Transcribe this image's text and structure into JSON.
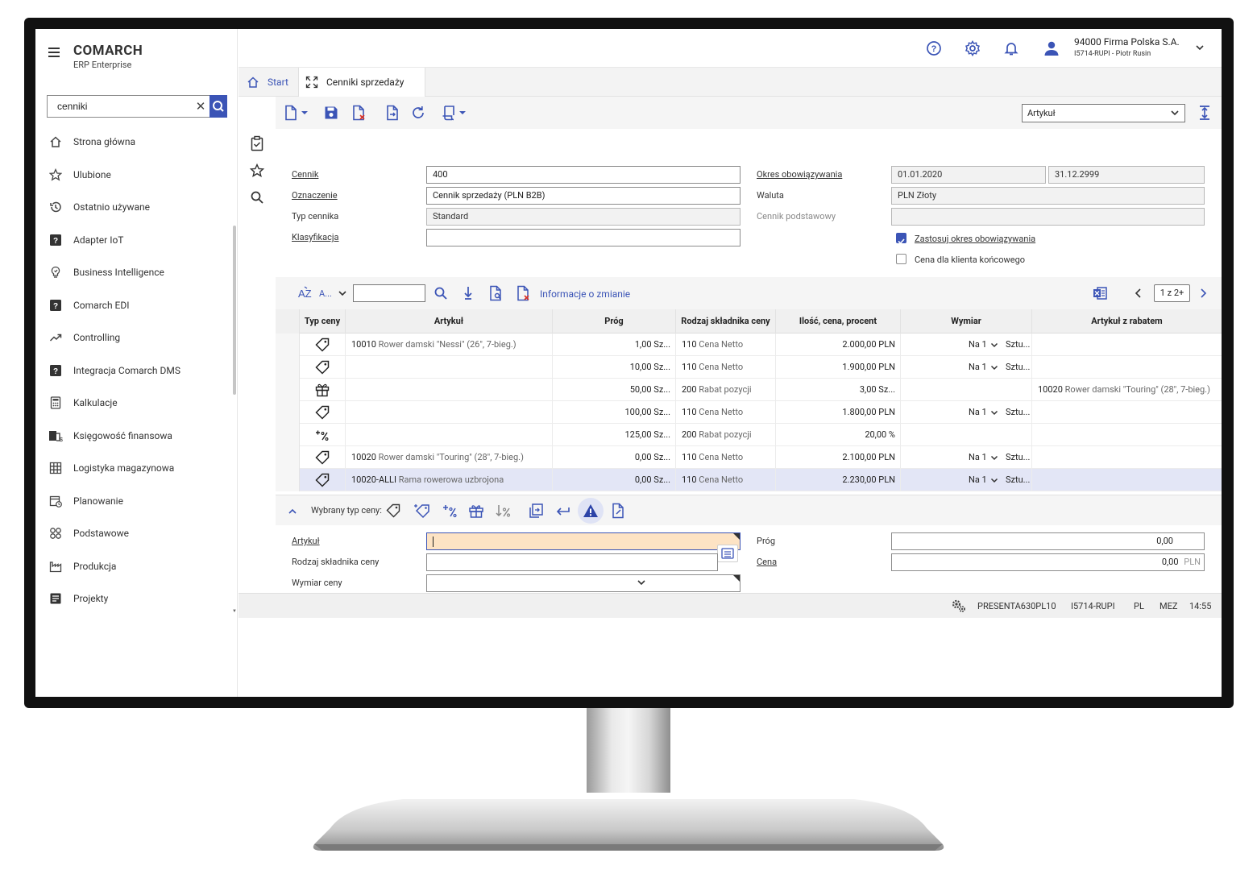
{
  "brand": {
    "name": "COMARCH",
    "product": "ERP Enterprise"
  },
  "search": {
    "value": "cenniki"
  },
  "sidebar": {
    "items": [
      {
        "label": "Strona główna"
      },
      {
        "label": "Ulubione"
      },
      {
        "label": "Ostatnio używane"
      },
      {
        "label": "Adapter IoT"
      },
      {
        "label": "Business Intelligence"
      },
      {
        "label": "Comarch EDI"
      },
      {
        "label": "Controlling"
      },
      {
        "label": "Integracja Comarch DMS"
      },
      {
        "label": "Kalkulacje"
      },
      {
        "label": "Księgowość finansowa"
      },
      {
        "label": "Logistyka magazynowa"
      },
      {
        "label": "Planowanie"
      },
      {
        "label": "Podstawowe"
      },
      {
        "label": "Produkcja"
      },
      {
        "label": "Projekty"
      }
    ]
  },
  "user": {
    "company": "94000  Firma Polska S.A.",
    "detail": "I5714-RUPI - Piotr Rusin"
  },
  "tabs": {
    "start": "Start",
    "active": "Cenniki sprzedaży"
  },
  "toolbar": {
    "view_select": "Artykuł"
  },
  "form": {
    "cennik_label": "Cennik",
    "cennik_value": "400",
    "oznaczenie_label": "Oznaczenie",
    "oznaczenie_value": "Cennik sprzedaży (PLN B2B)",
    "typ_label": "Typ cennika",
    "typ_value": "Standard",
    "klasyfikacja_label": "Klasyfikacja",
    "klasyfikacja_value": "",
    "okres_label": "Okres obowiązywania",
    "okres_from": "01.01.2020",
    "okres_to": "31.12.2999",
    "waluta_label": "Waluta",
    "waluta_value": "PLN Złoty",
    "podstawowy_label": "Cennik podstawowy",
    "podstawowy_value": "",
    "chk1_label": "Zastosuj okres obowiązywania",
    "chk1_checked": true,
    "chk2_label": "Cena dla klienta końcowego",
    "chk2_checked": false
  },
  "gridbar": {
    "sort_label": "A...",
    "link": "Informacje o zmianie",
    "pager": "1 z 2+"
  },
  "grid": {
    "headers": [
      "Typ ceny",
      "Artykuł",
      "Próg",
      "Rodzaj składnika ceny",
      "Ilość, cena, procent",
      "Wymiar",
      "Artykuł z rabatem"
    ],
    "rows": [
      {
        "icon": "tag",
        "art_code": "10010",
        "art_name": "Rower damski \"Nessi\" (26\", 7-bieg.)",
        "prog": "1,00 Sz...",
        "rodzaj_code": "110",
        "rodzaj_name": "Cena Netto",
        "ilosc": "2.000,00 PLN",
        "wymiar_a": "Na 1",
        "wymiar_b": "Sztu...",
        "rab_code": "",
        "rab_name": "",
        "selected": false
      },
      {
        "icon": "tag",
        "art_code": "",
        "art_name": "",
        "prog": "10,00 Sz...",
        "rodzaj_code": "110",
        "rodzaj_name": "Cena Netto",
        "ilosc": "1.900,00 PLN",
        "wymiar_a": "Na 1",
        "wymiar_b": "Sztu...",
        "rab_code": "",
        "rab_name": "",
        "selected": false
      },
      {
        "icon": "gift",
        "art_code": "",
        "art_name": "",
        "prog": "50,00 Sz...",
        "rodzaj_code": "200",
        "rodzaj_name": "Rabat pozycji",
        "ilosc": "3,00 Sz...",
        "wymiar_a": "",
        "wymiar_b": "",
        "rab_code": "10020",
        "rab_name": "Rower damski \"Touring\" (28\", 7-bieg.)",
        "selected": false
      },
      {
        "icon": "tag",
        "art_code": "",
        "art_name": "",
        "prog": "100,00 Sz...",
        "rodzaj_code": "110",
        "rodzaj_name": "Cena Netto",
        "ilosc": "1.800,00 PLN",
        "wymiar_a": "Na 1",
        "wymiar_b": "Sztu...",
        "rab_code": "",
        "rab_name": "",
        "selected": false
      },
      {
        "icon": "percent",
        "art_code": "",
        "art_name": "",
        "prog": "125,00 Sz...",
        "rodzaj_code": "200",
        "rodzaj_name": "Rabat pozycji",
        "ilosc": "20,00 %",
        "wymiar_a": "",
        "wymiar_b": "",
        "rab_code": "",
        "rab_name": "",
        "selected": false
      },
      {
        "icon": "tag",
        "art_code": "10020",
        "art_name": "Rower damski \"Touring\" (28\", 7-bieg.)",
        "prog": "0,00 Sz...",
        "rodzaj_code": "110",
        "rodzaj_name": "Cena Netto",
        "ilosc": "2.100,00 PLN",
        "wymiar_a": "Na 1",
        "wymiar_b": "Sztu...",
        "rab_code": "",
        "rab_name": "",
        "selected": false
      },
      {
        "icon": "tag",
        "art_code": "10020-ALLI",
        "art_name": "Rama rowerowa uzbrojona",
        "prog": "0,00 Sz...",
        "rodzaj_code": "110",
        "rodzaj_name": "Cena Netto",
        "ilosc": "2.230,00 PLN",
        "wymiar_a": "Na 1",
        "wymiar_b": "Sztu...",
        "rab_code": "",
        "rab_name": "",
        "selected": true
      }
    ]
  },
  "detail": {
    "bar_label": "Wybrany typ ceny:",
    "artykul_label": "Artykuł",
    "artykul_value": "",
    "rodzaj_label": "Rodzaj składnika ceny",
    "rodzaj_value": "",
    "wymiar_label": "Wymiar ceny",
    "wymiar_value": "",
    "prog_label": "Próg",
    "prog_value": "0,00",
    "cena_label": "Cena",
    "cena_value": "0,00",
    "cena_currency": "PLN"
  },
  "status": {
    "server": "PRESENTA630PL10",
    "user": "I5714-RUPI",
    "lang": "PL",
    "tz": "MEZ",
    "time": "14:55"
  },
  "colors": {
    "accent": "#3b54b6",
    "selected_row": "#e3e6f6",
    "required_field": "#fde3c4"
  }
}
